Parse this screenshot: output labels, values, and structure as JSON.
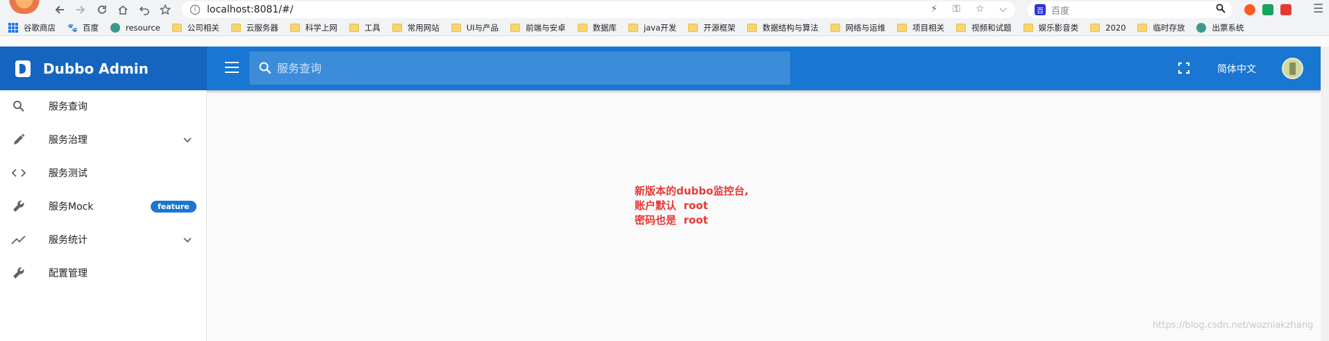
{
  "browser": {
    "url": "localhost:8081/#/",
    "search_placeholder": "百度",
    "search_engine_icon": "baidu-icon",
    "nav_icons": [
      "back-icon",
      "forward-icon",
      "reload-icon",
      "home-icon",
      "undo-icon",
      "star-icon"
    ]
  },
  "bookmarks": [
    {
      "label": "谷歌商店",
      "icon": "apps-icon"
    },
    {
      "label": "百度",
      "icon": "baidu-paw-icon"
    },
    {
      "label": "resource",
      "icon": "globe-icon"
    },
    {
      "label": "公司相关",
      "icon": "folder-icon"
    },
    {
      "label": "云服务器",
      "icon": "folder-icon"
    },
    {
      "label": "科学上网",
      "icon": "folder-icon"
    },
    {
      "label": "工具",
      "icon": "folder-icon"
    },
    {
      "label": "常用网站",
      "icon": "folder-icon"
    },
    {
      "label": "UI与产品",
      "icon": "folder-icon"
    },
    {
      "label": "前端与安卓",
      "icon": "folder-icon"
    },
    {
      "label": "数据库",
      "icon": "folder-icon"
    },
    {
      "label": "java开发",
      "icon": "folder-icon"
    },
    {
      "label": "开源框架",
      "icon": "folder-icon"
    },
    {
      "label": "数据结构与算法",
      "icon": "folder-icon"
    },
    {
      "label": "网络与运维",
      "icon": "folder-icon"
    },
    {
      "label": "项目相关",
      "icon": "folder-icon"
    },
    {
      "label": "视频和试题",
      "icon": "folder-icon"
    },
    {
      "label": "娱乐影音类",
      "icon": "folder-icon"
    },
    {
      "label": "2020",
      "icon": "folder-icon"
    },
    {
      "label": "临时存放",
      "icon": "folder-icon"
    },
    {
      "label": "出票系统",
      "icon": "globe-icon"
    }
  ],
  "app": {
    "title": "Dubbo Admin",
    "search_placeholder": "服务查询",
    "language": "简体中文",
    "colors": {
      "primary": "#1976d2",
      "brand": "#1565c0",
      "notice": "#e53935"
    }
  },
  "sidebar": {
    "items": [
      {
        "label": "服务查询",
        "icon": "search-icon"
      },
      {
        "label": "服务治理",
        "icon": "pencil-icon",
        "expandable": true
      },
      {
        "label": "服务测试",
        "icon": "code-icon"
      },
      {
        "label": "服务Mock",
        "icon": "wrench-icon",
        "badge": "feature"
      },
      {
        "label": "服务统计",
        "icon": "trending-icon",
        "expandable": true
      },
      {
        "label": "配置管理",
        "icon": "wrench-icon"
      }
    ]
  },
  "notice": {
    "line1": "新版本的dubbo监控台,",
    "line2": "账户默认  root",
    "line3": "密码也是  root"
  },
  "watermark": "https://blog.csdn.net/wozniakzhang"
}
